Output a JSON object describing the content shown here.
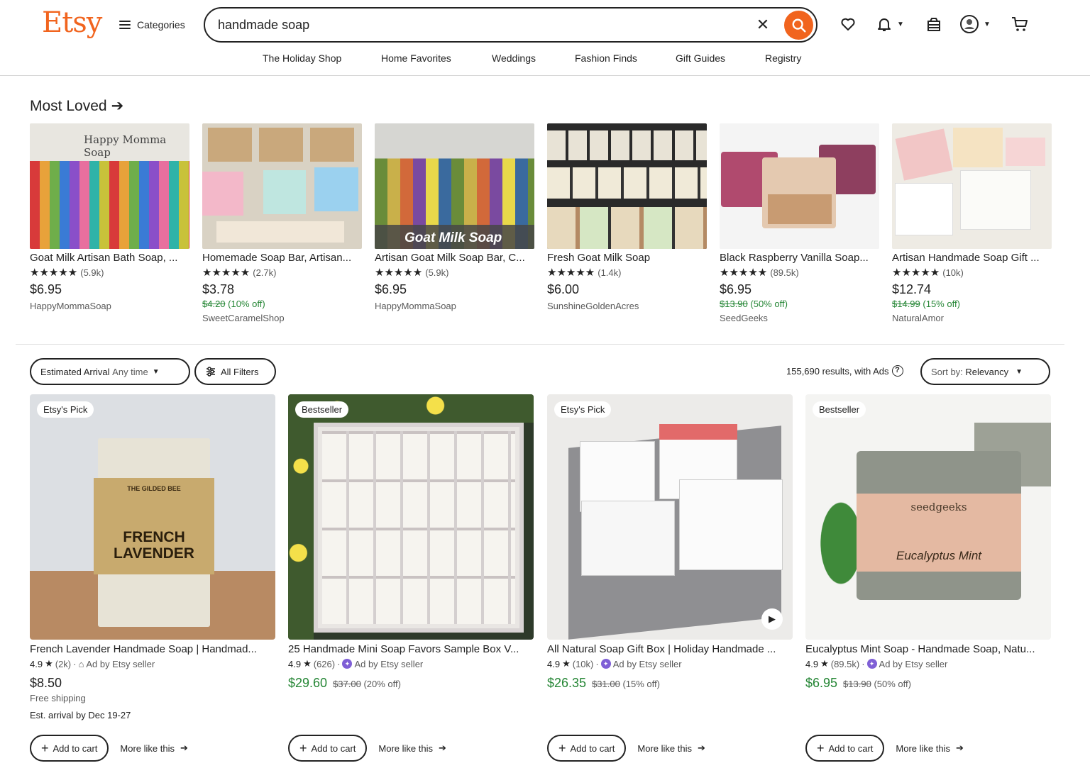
{
  "header": {
    "logo": "Etsy",
    "categories_label": "Categories",
    "search_value": "handmade soap",
    "nav": [
      "The Holiday Shop",
      "Home Favorites",
      "Weddings",
      "Fashion Finds",
      "Gift Guides",
      "Registry"
    ]
  },
  "colors": {
    "brand": "#f1641e",
    "sale": "#258635",
    "ad": "#7f5fd6"
  },
  "icons": [
    "search-icon",
    "close-icon",
    "heart-icon",
    "bell-icon",
    "gift-icon",
    "user-icon",
    "cart-icon"
  ],
  "most_loved": {
    "title": "Most Loved",
    "items": [
      {
        "title": "Goat Milk Artisan Bath Soap, ...",
        "stars": "★★★★★",
        "reviews": "(5.9k)",
        "price": "$6.95",
        "orig": "",
        "discount": "",
        "shop": "HappyMommaSoap",
        "img_text": "Happy Momma Soap"
      },
      {
        "title": "Homemade Soap Bar, Artisan...",
        "stars": "★★★★★",
        "reviews": "(2.7k)",
        "price": "$3.78",
        "orig": "$4.20",
        "discount": "(10% off)",
        "shop": "SweetCaramelShop",
        "img_text": ""
      },
      {
        "title": "Artisan Goat Milk Soap Bar, C...",
        "stars": "★★★★★",
        "reviews": "(5.9k)",
        "price": "$6.95",
        "orig": "",
        "discount": "",
        "shop": "HappyMommaSoap",
        "img_text": "Goat Milk Soap"
      },
      {
        "title": "Fresh Goat Milk Soap",
        "stars": "★★★★★",
        "reviews": "(1.4k)",
        "price": "$6.00",
        "orig": "",
        "discount": "",
        "shop": "SunshineGoldenAcres",
        "img_text": ""
      },
      {
        "title": "Black Raspberry Vanilla Soap...",
        "stars": "★★★★★",
        "reviews": "(89.5k)",
        "price": "$6.95",
        "orig": "$13.90",
        "discount": "(50% off)",
        "shop": "SeedGeeks",
        "img_text": ""
      },
      {
        "title": "Artisan Handmade Soap Gift ...",
        "stars": "★★★★★",
        "reviews": "(10k)",
        "price": "$12.74",
        "orig": "$14.99",
        "discount": "(15% off)",
        "shop": "NaturalAmor",
        "img_text": ""
      }
    ]
  },
  "filters": {
    "arrival_label": "Estimated Arrival",
    "arrival_value": "Any time",
    "all_filters": "All Filters",
    "results": "155,690 results, with Ads",
    "sort_label": "Sort by:",
    "sort_value": "Relevancy"
  },
  "listings": [
    {
      "badge": "Etsy's Pick",
      "title": "French Lavender Handmade Soap | Handmad...",
      "rating": "4.9",
      "reviews": "(2k)",
      "ad": "Ad by Etsy seller",
      "price": "$8.50",
      "orig": "",
      "discount": "",
      "shipping": "Free shipping",
      "arrival": "Est. arrival by Dec 19-27",
      "add": "Add to cart",
      "more": "More like this",
      "soap_brand": "THE GILDED BEE",
      "soap_name": "FRENCH LAVENDER"
    },
    {
      "badge": "Bestseller",
      "title": "25 Handmade Mini Soap Favors Sample Box V...",
      "rating": "4.9",
      "reviews": "(626)",
      "ad": "Ad by Etsy seller",
      "price": "$29.60",
      "orig": "$37.00",
      "discount": "(20% off)",
      "shipping": "",
      "arrival": "",
      "add": "Add to cart",
      "more": "More like this"
    },
    {
      "badge": "Etsy's Pick",
      "title": "All Natural Soap Gift Box | Holiday Handmade ...",
      "rating": "4.9",
      "reviews": "(10k)",
      "ad": "Ad by Etsy seller",
      "price": "$26.35",
      "orig": "$31.00",
      "discount": "(15% off)",
      "shipping": "",
      "arrival": "",
      "add": "Add to cart",
      "more": "More like this"
    },
    {
      "badge": "Bestseller",
      "title": "Eucalyptus Mint Soap - Handmade Soap, Natu...",
      "rating": "4.9",
      "reviews": "(89.5k)",
      "ad": "Ad by Etsy seller",
      "price": "$6.95",
      "orig": "$13.90",
      "discount": "(50% off)",
      "shipping": "",
      "arrival": "",
      "add": "Add to cart",
      "more": "More like this",
      "soap_brand": "seedgeeks",
      "soap_name": "Eucalyptus Mint"
    }
  ]
}
